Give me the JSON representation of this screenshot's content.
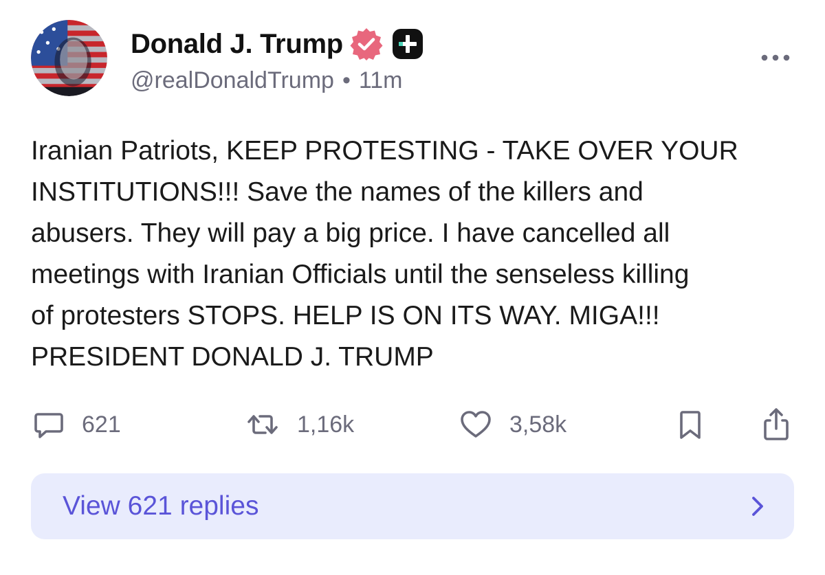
{
  "author": {
    "display_name": "Donald J. Trump",
    "handle": "@realDonaldTrump",
    "separator": "•",
    "time_ago": "11m"
  },
  "icons": {
    "verified": "verified-badge-icon",
    "plus": "plus-badge-icon",
    "more": "more-options-icon",
    "reply": "comment-icon",
    "repost": "repost-icon",
    "like": "heart-icon",
    "bookmark": "bookmark-icon",
    "share": "share-icon",
    "chevron": "chevron-right-icon"
  },
  "post": {
    "text": "Iranian Patriots, KEEP PROTESTING - TAKE OVER YOUR\nINSTITUTIONS!!! Save the names of the killers and\nabusers. They will pay a big price. I have cancelled all\nmeetings with Iranian Officials until the senseless killing\nof protesters STOPS. HELP IS ON ITS WAY. MIGA!!!\nPRESIDENT DONALD J. TRUMP"
  },
  "stats": {
    "replies": "621",
    "reposts": "1,16k",
    "likes": "3,58k"
  },
  "replies_bar": {
    "label": "View 621 replies"
  },
  "colors": {
    "verified_badge": "#e8677d",
    "plus_badge": "#111111",
    "plus_accent": "#4cd4b8",
    "secondary_text": "#6b6b7b",
    "replies_bar_bg": "#e9ecfd",
    "replies_bar_text": "#5a54d8"
  }
}
